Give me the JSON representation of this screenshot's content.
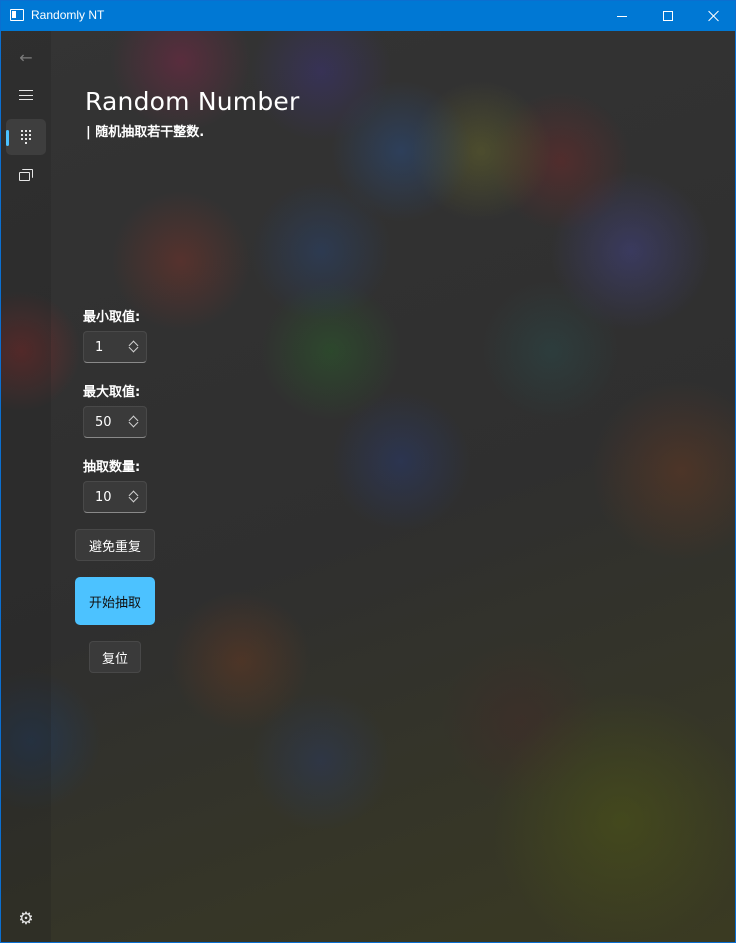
{
  "window": {
    "title": "Randomly NT",
    "accent": "#0078d4"
  },
  "nav": {
    "items": [
      {
        "name": "back",
        "icon": "arrow-left-icon"
      },
      {
        "name": "menu",
        "icon": "hamburger-icon"
      },
      {
        "name": "random-number",
        "icon": "dot-grid-icon",
        "selected": true
      },
      {
        "name": "list",
        "icon": "stacked-windows-icon"
      },
      {
        "name": "settings",
        "icon": "gear-icon"
      }
    ],
    "back_glyph": "←",
    "settings_glyph": "⚙"
  },
  "page": {
    "title": "Random Number",
    "subtitle": "| 随机抽取若干整数."
  },
  "fields": {
    "min": {
      "label": "最小取值:",
      "value": "1"
    },
    "max": {
      "label": "最大取值:",
      "value": "50"
    },
    "count": {
      "label": "抽取数量:",
      "value": "10"
    }
  },
  "buttons": {
    "avoid_repeat": "避免重复",
    "start": "开始抽取",
    "reset": "复位",
    "start_color": "#4cc2ff"
  }
}
